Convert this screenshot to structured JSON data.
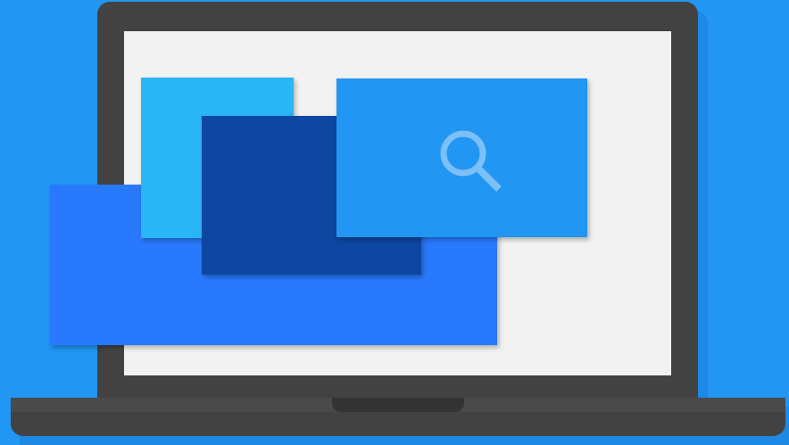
{
  "illustration": {
    "subject": "laptop-with-overlapping-windows",
    "icons": [
      "search-icon"
    ],
    "colors": {
      "background": "#2196F3",
      "laptop_body": "#424242",
      "screen": "#F1F2F1",
      "window_large": "#2979FF",
      "window_light": "#29B6F6",
      "window_dark": "#0D47A1",
      "window_search": "#2196F3",
      "search_icon": "#7CC0F7"
    }
  }
}
